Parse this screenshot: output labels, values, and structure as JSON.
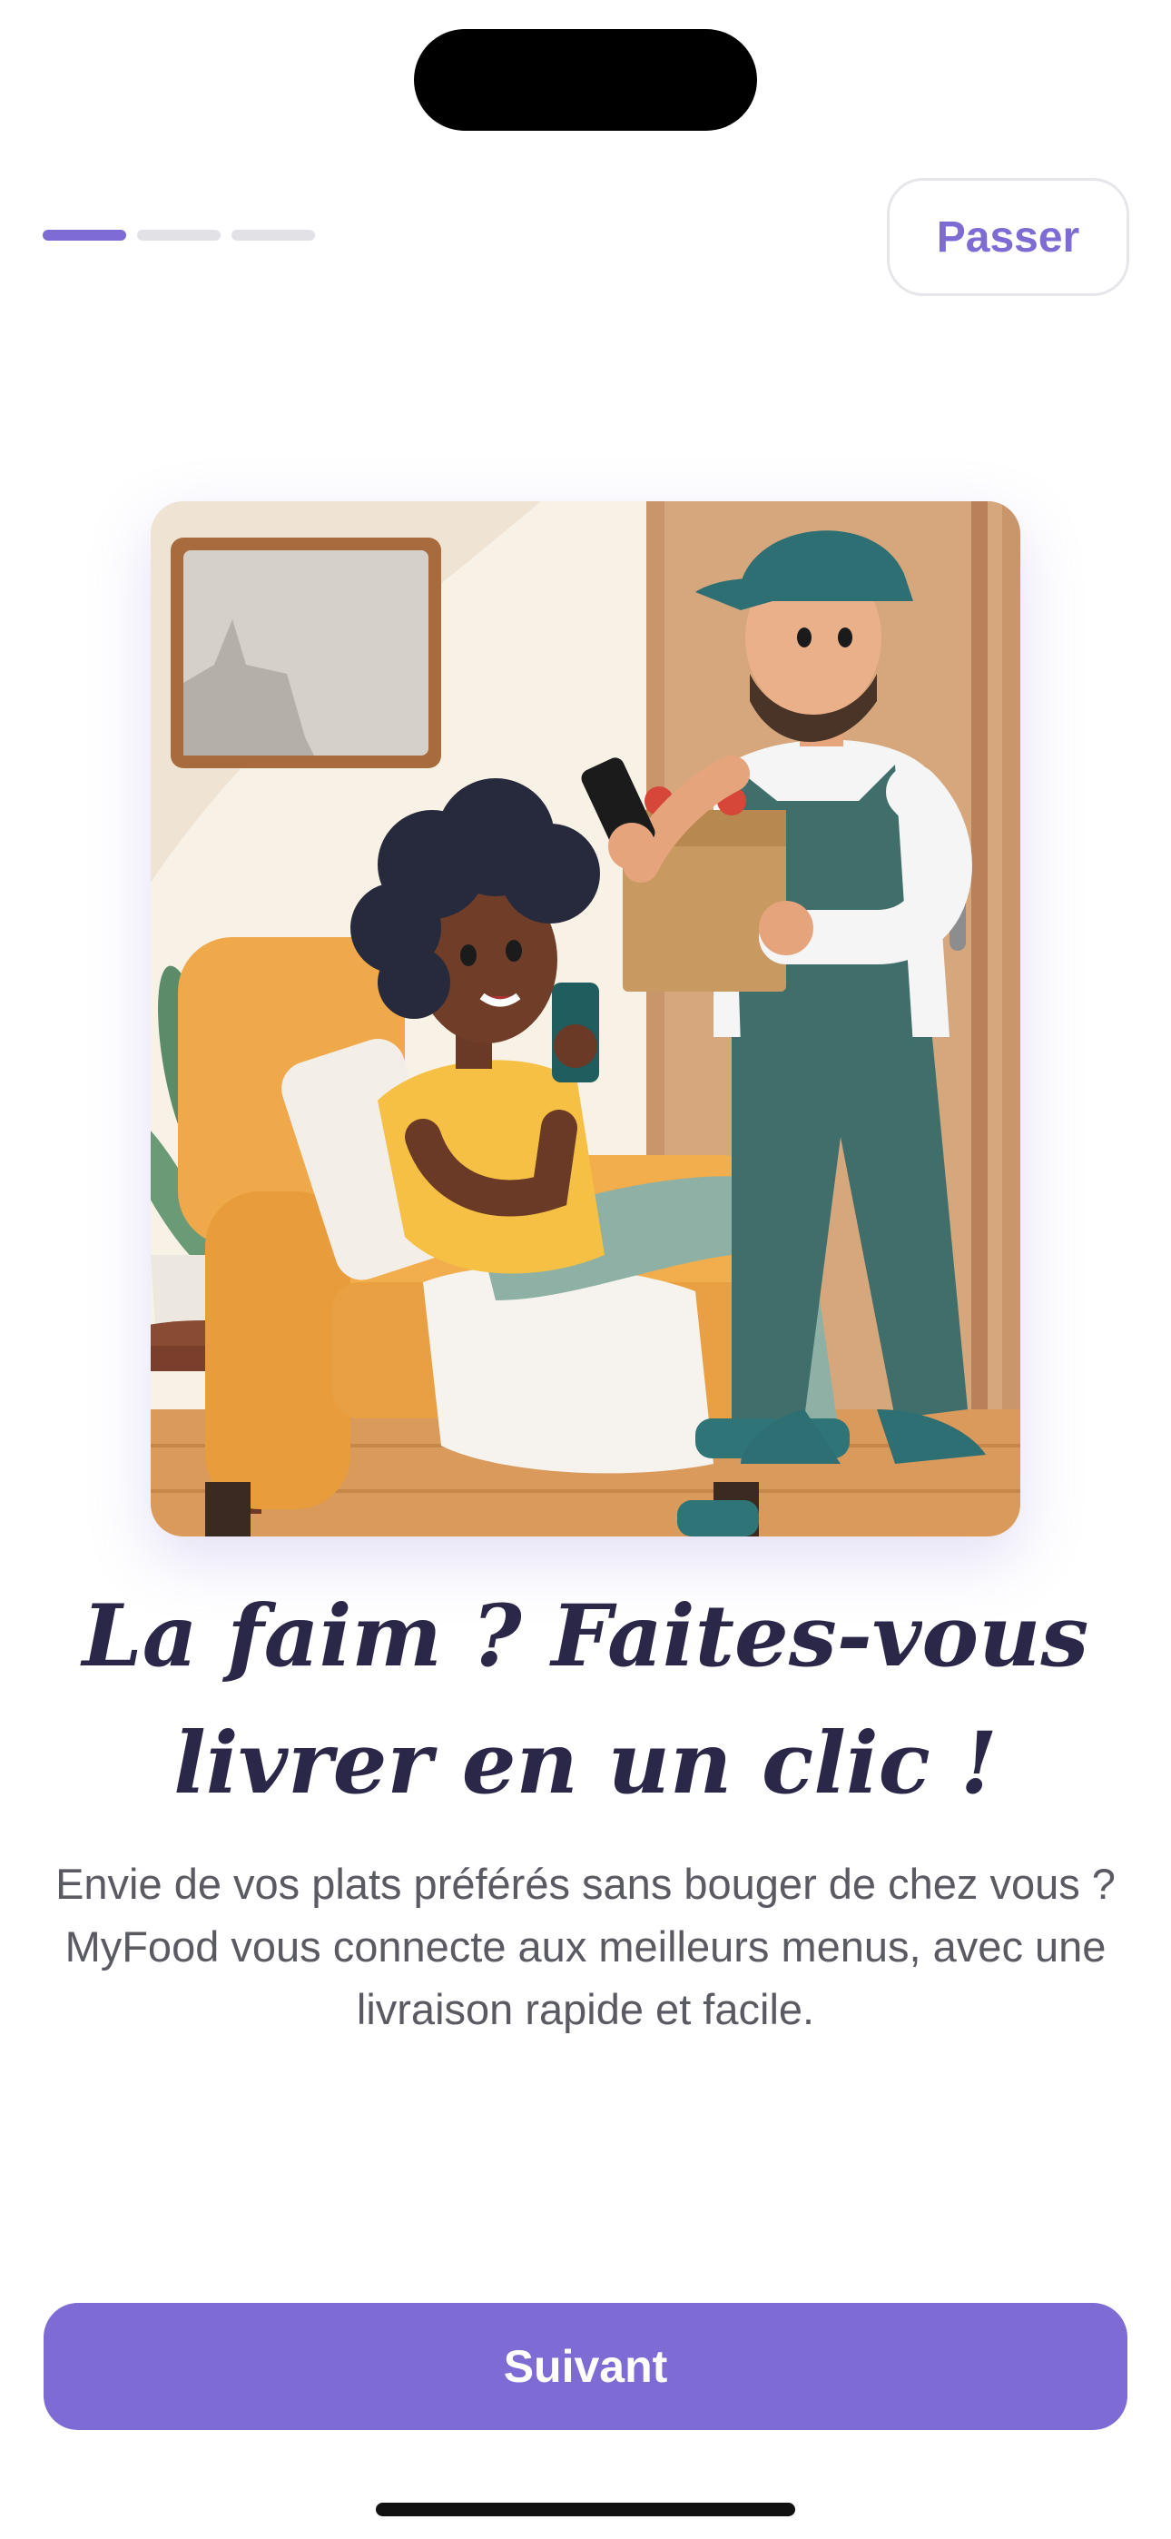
{
  "onboarding": {
    "step_current": 1,
    "step_total": 3,
    "skip_label": "Passer",
    "headline": "La faim ? Faites-vous livrer en un clic !",
    "description": "Envie de vos plats préférés sans bouger de chez vous ? MyFood vous connecte aux meilleurs menus, avec une livraison rapide et facile.",
    "next_label": "Suivant"
  },
  "colors": {
    "accent": "#7e6bd3",
    "headline": "#2b2749",
    "body_text": "#5a5a62",
    "inactive_indicator": "#e2e2e6"
  },
  "illustration": {
    "icon": "delivery-illustration"
  }
}
